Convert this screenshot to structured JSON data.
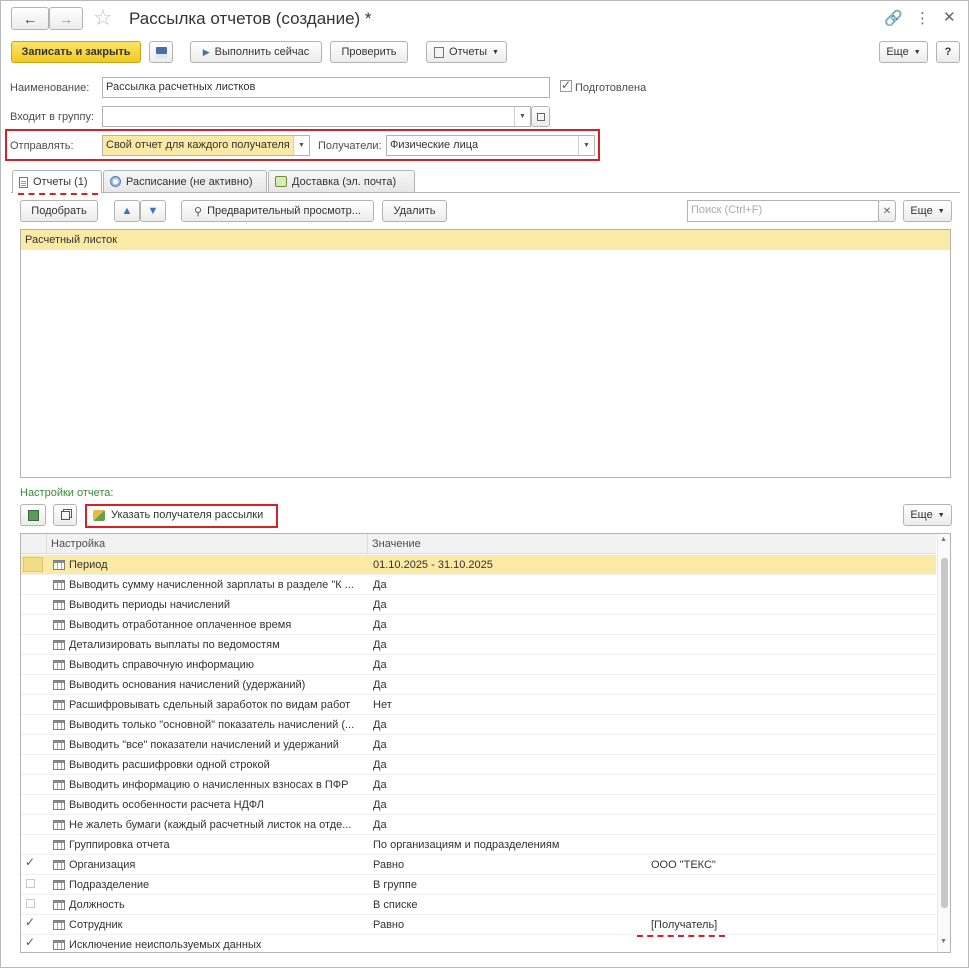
{
  "window": {
    "title": "Рассылка отчетов (создание) *"
  },
  "toolbar": {
    "save_close": "Записать и закрыть",
    "run_now": "Выполнить сейчас",
    "check": "Проверить",
    "reports": "Отчеты",
    "more": "Еще",
    "help": "?"
  },
  "form": {
    "name_label": "Наименование:",
    "name_value": "Рассылка расчетных листков",
    "prepared_label": "Подготовлена",
    "group_label": "Входит в группу:",
    "group_value": "",
    "send_label": "Отправлять:",
    "send_value": "Свой отчет для каждого получателя",
    "recipients_label": "Получатели:",
    "recipients_value": "Физические лица"
  },
  "tabs": [
    {
      "label": "Отчеты (1)"
    },
    {
      "label": "Расписание (не активно)"
    },
    {
      "label": "Доставка (эл. почта)"
    }
  ],
  "reports_bar": {
    "pick": "Подобрать",
    "preview": "Предварительный просмотр...",
    "delete": "Удалить",
    "search_placeholder": "Поиск (Ctrl+F)",
    "more": "Еще"
  },
  "reports_list": [
    "Расчетный листок"
  ],
  "settings": {
    "title": "Настройки отчета:",
    "specify_recipient": "Указать получателя рассылки",
    "more": "Еще",
    "col_setting": "Настройка",
    "col_value": "Значение",
    "rows": [
      {
        "name": "Период",
        "value": "01.10.2025 - 31.10.2025",
        "extra": "",
        "check": "sel"
      },
      {
        "name": "Выводить сумму начисленной зарплаты в разделе \"К ...",
        "value": "Да",
        "extra": "",
        "check": ""
      },
      {
        "name": "Выводить периоды начислений",
        "value": "Да",
        "extra": "",
        "check": ""
      },
      {
        "name": "Выводить отработанное оплаченное время",
        "value": "Да",
        "extra": "",
        "check": ""
      },
      {
        "name": "Детализировать выплаты по ведомостям",
        "value": "Да",
        "extra": "",
        "check": ""
      },
      {
        "name": "Выводить справочную информацию",
        "value": "Да",
        "extra": "",
        "check": ""
      },
      {
        "name": "Выводить основания начислений (удержаний)",
        "value": "Да",
        "extra": "",
        "check": ""
      },
      {
        "name": "Расшифровывать сдельный заработок по видам работ",
        "value": "Нет",
        "extra": "",
        "check": ""
      },
      {
        "name": "Выводить только \"основной\" показатель начислений (...",
        "value": "Да",
        "extra": "",
        "check": ""
      },
      {
        "name": "Выводить \"все\" показатели начислений и удержаний",
        "value": "Да",
        "extra": "",
        "check": ""
      },
      {
        "name": "Выводить расшифровки одной строкой",
        "value": "Да",
        "extra": "",
        "check": ""
      },
      {
        "name": "Выводить информацию о начисленных взносах в ПФР",
        "value": "Да",
        "extra": "",
        "check": ""
      },
      {
        "name": "Выводить особенности расчета НДФЛ",
        "value": "Да",
        "extra": "",
        "check": ""
      },
      {
        "name": "Не жалеть бумаги (каждый расчетный листок на отде...",
        "value": "Да",
        "extra": "",
        "check": ""
      },
      {
        "name": "Группировка отчета",
        "value": "По организациям и подразделениям",
        "extra": "",
        "check": ""
      },
      {
        "name": "Организация",
        "value": "Равно",
        "extra": "ООО \"ТЕКС\"",
        "check": "on"
      },
      {
        "name": "Подразделение",
        "value": "В группе",
        "extra": "",
        "check": "off"
      },
      {
        "name": "Должность",
        "value": "В списке",
        "extra": "",
        "check": "off"
      },
      {
        "name": "Сотрудник",
        "value": "Равно",
        "extra": "[Получатель]",
        "check": "on"
      },
      {
        "name": "Исключение неиспользуемых данных",
        "value": "",
        "extra": "",
        "check": "on"
      }
    ]
  },
  "colors": {
    "accent_yellow": "#f3c91f",
    "highlight": "#fbe9a6",
    "annotation_red": "#d9202a"
  }
}
